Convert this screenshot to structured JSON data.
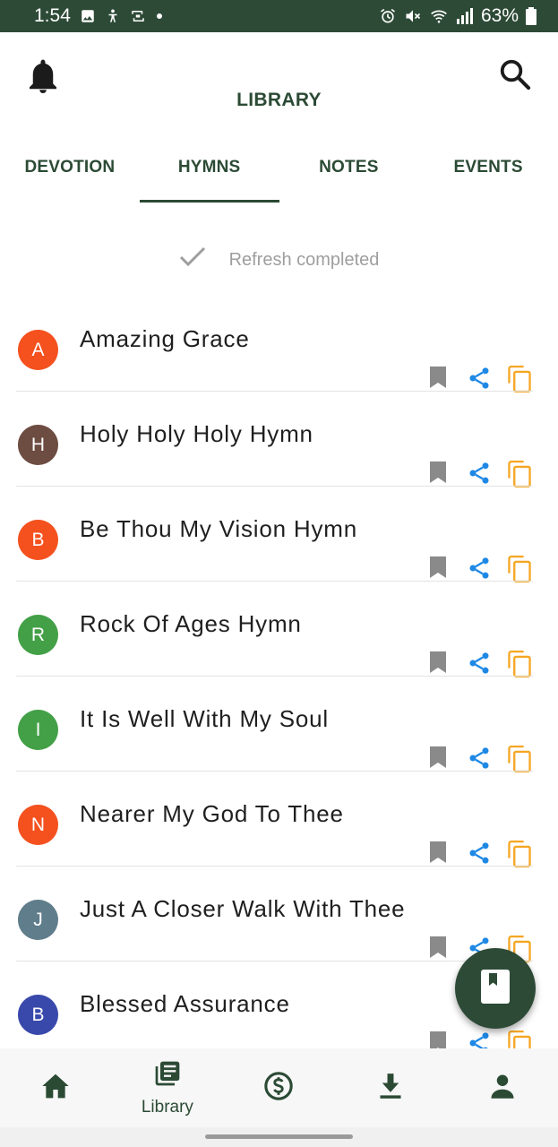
{
  "status_bar": {
    "time": "1:54",
    "battery": "63%",
    "left_icons": [
      "image-icon",
      "accessibility-icon",
      "cast-icon",
      "dot-icon"
    ],
    "right_icons": [
      "alarm-icon",
      "mute-icon",
      "wifi-icon",
      "signal-icon",
      "battery-icon"
    ]
  },
  "header": {
    "title": "LIBRARY",
    "left_icon": "bell-icon",
    "right_icon": "search-icon"
  },
  "tabs": [
    {
      "label": "DEVOTION",
      "active": false
    },
    {
      "label": "HYMNS",
      "active": true
    },
    {
      "label": "NOTES",
      "active": false
    },
    {
      "label": "EVENTS",
      "active": false
    }
  ],
  "refresh": {
    "icon": "check-icon",
    "text": "Refresh completed"
  },
  "hymns": [
    {
      "letter": "A",
      "title": "Amazing Grace",
      "color": "#f4511e"
    },
    {
      "letter": "H",
      "title": "Holy Holy Holy Hymn",
      "color": "#6d4c41"
    },
    {
      "letter": "B",
      "title": "Be Thou My Vision Hymn",
      "color": "#f4511e"
    },
    {
      "letter": "R",
      "title": "Rock Of Ages Hymn",
      "color": "#43a047"
    },
    {
      "letter": "I",
      "title": "It Is Well With My Soul",
      "color": "#43a047"
    },
    {
      "letter": "N",
      "title": "Nearer My God To Thee",
      "color": "#f4511e"
    },
    {
      "letter": "J",
      "title": "Just A Closer Walk With Thee",
      "color": "#607d8b"
    },
    {
      "letter": "B",
      "title": "Blessed Assurance",
      "color": "#3949ab"
    }
  ],
  "row_actions": {
    "bookmark_icon": "bookmark-icon",
    "share_icon": "share-icon",
    "copy_icon": "copy-icon",
    "bookmark_color": "#8a8a8a",
    "share_color": "#1e88e5",
    "copy_color": "#f5a623"
  },
  "fab": {
    "icon": "book-icon"
  },
  "bottom_nav": [
    {
      "icon": "home-icon",
      "label": ""
    },
    {
      "icon": "library-icon",
      "label": "Library"
    },
    {
      "icon": "dollar-icon",
      "label": ""
    },
    {
      "icon": "download-icon",
      "label": ""
    },
    {
      "icon": "profile-icon",
      "label": ""
    }
  ],
  "colors": {
    "primary": "#2d4a36",
    "text_primary": "#2b4a34"
  }
}
